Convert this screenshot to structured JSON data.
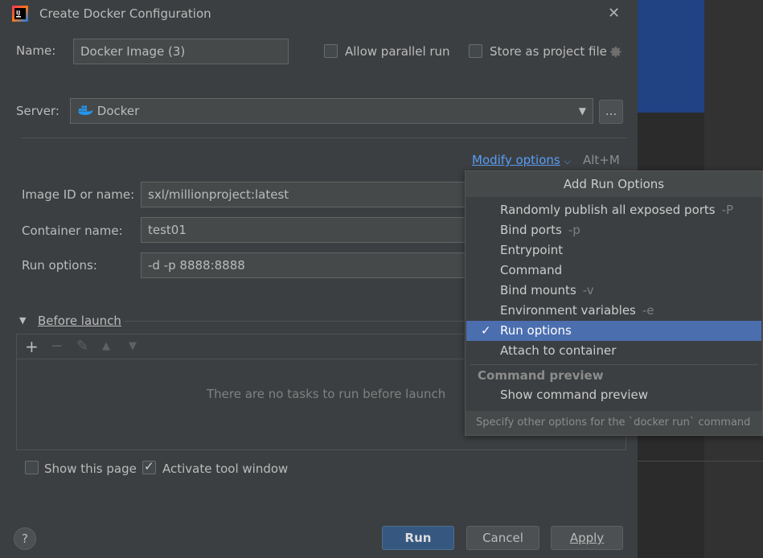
{
  "window": {
    "title": "Create Docker Configuration",
    "close_glyph": "✕"
  },
  "form": {
    "name_label": "Name:",
    "name_value": "Docker Image (3)",
    "allow_parallel_label": "Allow parallel run",
    "store_project_label": "Store as project file",
    "server_label": "Server:",
    "server_value": "Docker",
    "browse_label": "...",
    "modify_options_label": "Modify options",
    "modify_shortcut": "Alt+M",
    "image_label": "Image ID or name:",
    "image_value": "sxl/millionproject:latest",
    "container_label": "Container name:",
    "container_value": "test01",
    "run_options_label": "Run options:",
    "run_options_value": "-d -p 8888:8888"
  },
  "before_launch": {
    "title": "Before launch",
    "empty_text": "There are no tasks to run before launch",
    "tools": {
      "add": "+",
      "remove": "−",
      "edit": "✎",
      "up": "▲",
      "down": "▼"
    }
  },
  "footer": {
    "show_page_label": "Show this page",
    "show_page_checked": false,
    "activate_tool_label": "Activate tool window",
    "activate_tool_checked": true,
    "help": "?",
    "run": "Run",
    "cancel": "Cancel",
    "apply": "Apply"
  },
  "popup": {
    "title": "Add Run Options",
    "items": [
      {
        "label": "Randomly publish all exposed ports",
        "shortcut": "-P",
        "selected": false
      },
      {
        "label": "Bind ports",
        "shortcut": "-p",
        "selected": false
      },
      {
        "label": "Entrypoint",
        "shortcut": "",
        "selected": false
      },
      {
        "label": "Command",
        "shortcut": "",
        "selected": false
      },
      {
        "label": "Bind mounts",
        "shortcut": "-v",
        "selected": false
      },
      {
        "label": "Environment variables",
        "shortcut": "-e",
        "selected": false
      },
      {
        "label": "Run options",
        "shortcut": "",
        "selected": true
      },
      {
        "label": "Attach to container",
        "shortcut": "",
        "selected": false
      }
    ],
    "section_title": "Command preview",
    "section_items": [
      {
        "label": "Show command preview"
      }
    ],
    "footer_text": "Specify other options for the `docker run` command",
    "check_glyph": "✓"
  },
  "colors": {
    "accent": "#4b6eaf",
    "link": "#589df6",
    "primary_button": "#365880"
  }
}
